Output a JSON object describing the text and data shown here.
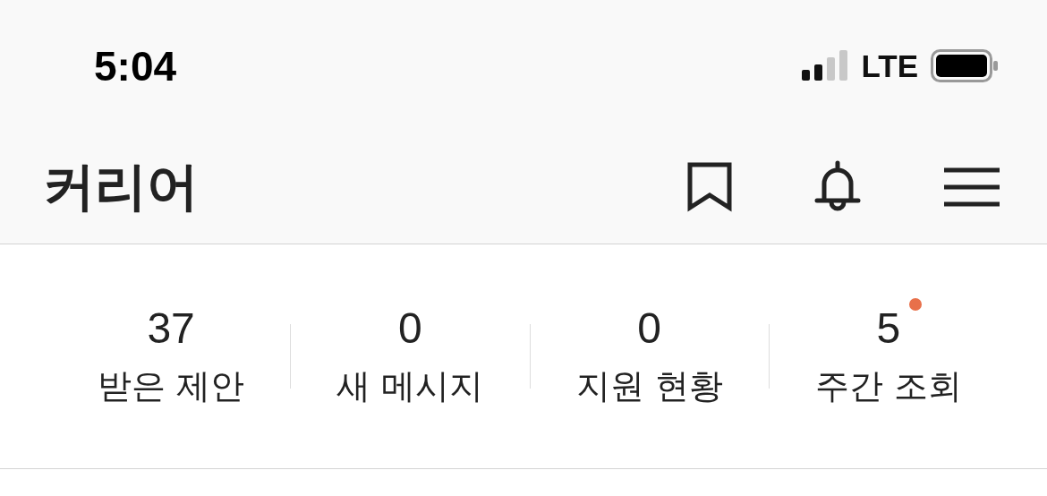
{
  "status_bar": {
    "time": "5:04",
    "network": "LTE"
  },
  "header": {
    "title": "커리어"
  },
  "stats": [
    {
      "value": "37",
      "label": "받은 제안",
      "new": false
    },
    {
      "value": "0",
      "label": "새 메시지",
      "new": false
    },
    {
      "value": "0",
      "label": "지원 현황",
      "new": false
    },
    {
      "value": "5",
      "label": "주간 조회",
      "new": true
    }
  ]
}
